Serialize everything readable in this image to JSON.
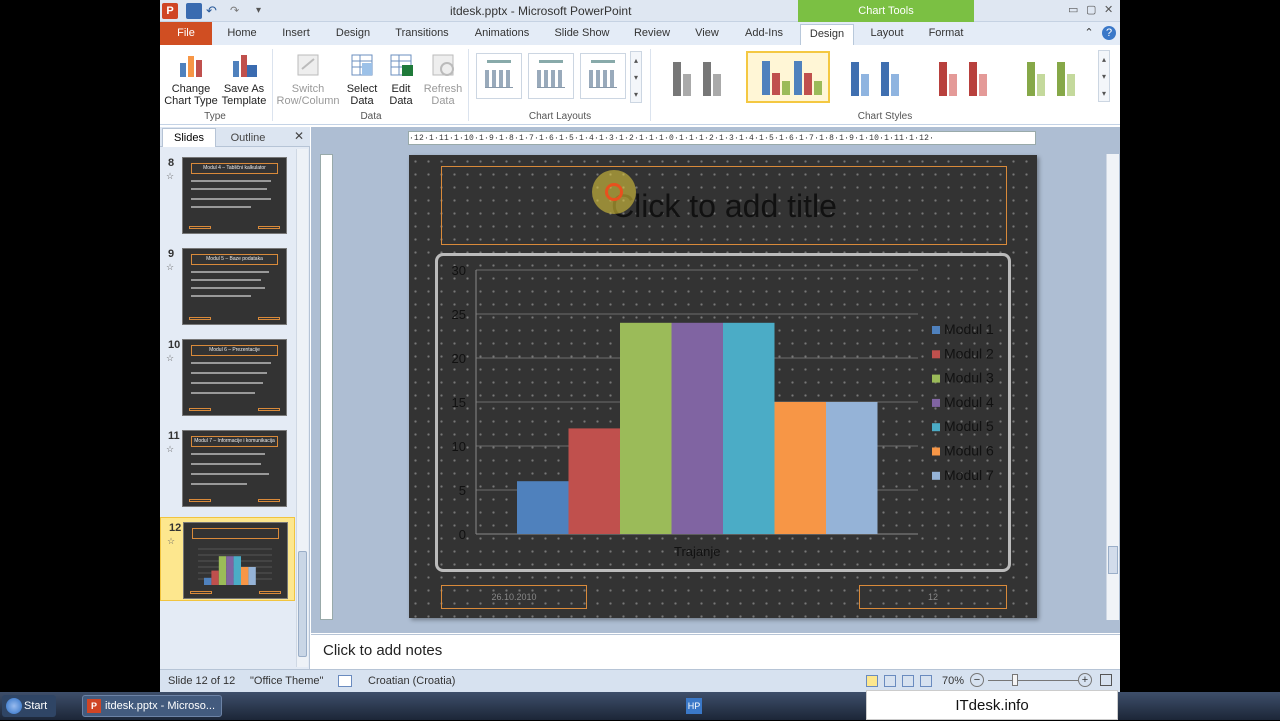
{
  "window": {
    "title": "itdesk.pptx - Microsoft PowerPoint",
    "ppt_logo": "P",
    "undo_glyph": "↶",
    "redo_glyph": "↷",
    "qat_more": "▾",
    "win_min": "▭",
    "win_max": "▢",
    "win_close": "✕"
  },
  "ribbon": {
    "chart_tools_label": "Chart Tools",
    "tabs": [
      "File",
      "Home",
      "Insert",
      "Design",
      "Transitions",
      "Animations",
      "Slide Show",
      "Review",
      "View",
      "Add-Ins",
      "Design",
      "Layout",
      "Format"
    ],
    "minimize_glyph": "⌃",
    "help_glyph": "?",
    "groups": {
      "type": {
        "label": "Type",
        "change_chart_type": "Change Chart Type",
        "save_as_template": "Save As Template"
      },
      "data": {
        "label": "Data",
        "switch_row_column": "Switch Row/Column",
        "select_data": "Select Data",
        "edit_data": "Edit Data",
        "refresh_data": "Refresh Data"
      },
      "chart_layouts": {
        "label": "Chart Layouts"
      },
      "chart_styles": {
        "label": "Chart Styles"
      }
    }
  },
  "slides_panel": {
    "tab_slides": "Slides",
    "tab_outline": "Outline",
    "close": "✕",
    "thumbs": [
      {
        "num": "8",
        "title": "Modul 4 – Tablični kalkulator"
      },
      {
        "num": "9",
        "title": "Modul 5 – Baze podataka"
      },
      {
        "num": "10",
        "title": "Modul 6 – Prezentacije"
      },
      {
        "num": "11",
        "title": "Modul 7 – Informacije i komunikacija"
      },
      {
        "num": "12",
        "title": ""
      }
    ],
    "star": "☆"
  },
  "ruler": {
    "horizontal": "·12·1·11·1·10·1·9·1·8·1·7·1·6·1·5·1·4·1·3·1·2·1·1·1·0·1·1·1·2·1·3·1·4·1·5·1·6·1·7·1·8·1·9·1·10·1·11·1·12·"
  },
  "slide": {
    "title_placeholder": "Click to add title",
    "date": "26.10.2010",
    "slide_number": "12"
  },
  "chart_data": {
    "type": "bar",
    "categories": [
      "Trajanje"
    ],
    "series": [
      {
        "name": "Modul 1",
        "values": [
          6
        ],
        "color": "#4f81bd"
      },
      {
        "name": "Modul 2",
        "values": [
          12
        ],
        "color": "#c0504d"
      },
      {
        "name": "Modul 3",
        "values": [
          24
        ],
        "color": "#9bbb59"
      },
      {
        "name": "Modul 4",
        "values": [
          24
        ],
        "color": "#8064a2"
      },
      {
        "name": "Modul 5",
        "values": [
          24
        ],
        "color": "#4bacc6"
      },
      {
        "name": "Modul 6",
        "values": [
          15
        ],
        "color": "#f79646"
      },
      {
        "name": "Modul 7",
        "values": [
          15
        ],
        "color": "#95b3d7"
      }
    ],
    "yticks": [
      0,
      5,
      10,
      15,
      20,
      25,
      30
    ],
    "ylim": [
      0,
      30
    ],
    "xlabel": "Trajanje",
    "legend": "right",
    "grid": true
  },
  "notes": {
    "placeholder": "Click to add notes"
  },
  "status": {
    "slide_of": "Slide 12 of 12",
    "theme": "\"Office Theme\"",
    "language": "Croatian (Croatia)",
    "zoom": "70%",
    "zoom_out": "−",
    "zoom_in": "+"
  },
  "taskbar": {
    "start": "Start",
    "ppt_window": "itdesk.pptx - Microso...",
    "tray_hp": "HP"
  },
  "brand": "ITdesk.info"
}
